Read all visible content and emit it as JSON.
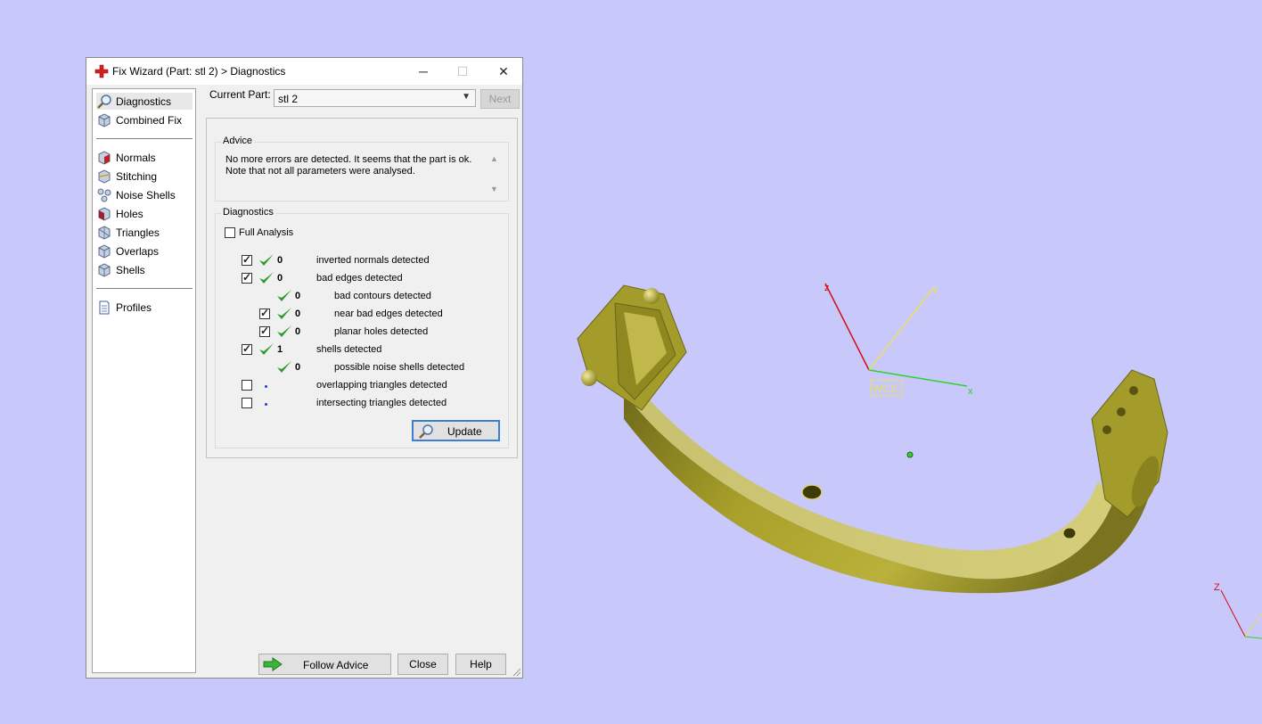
{
  "colors": {
    "viewport_bg": "#c8c8fa",
    "part": "#a8a02a",
    "axis_x": "#30d030",
    "axis_y": "#e8e060",
    "axis_z": "#d01010",
    "check": "#2e9a2e",
    "follow_arrow": "#3cb43c"
  },
  "dialog": {
    "title": "Fix Wizard (Part: stl 2) > Diagnostics",
    "title_icon": "red-cross-icon",
    "window_buttons": {
      "minimize": "─",
      "maximize": "☐",
      "close": "✕"
    }
  },
  "sidebar": {
    "items": [
      {
        "label": "Diagnostics",
        "icon": "magnifier-icon"
      },
      {
        "label": "Combined Fix",
        "icon": "cube-icon"
      },
      {
        "label": "Normals",
        "icon": "cube-red-face-icon"
      },
      {
        "label": "Stitching",
        "icon": "cube-stitch-icon"
      },
      {
        "label": "Noise Shells",
        "icon": "noise-shells-icon"
      },
      {
        "label": "Holes",
        "icon": "cube-hole-icon"
      },
      {
        "label": "Triangles",
        "icon": "cube-triangles-icon"
      },
      {
        "label": "Overlaps",
        "icon": "cube-overlap-icon"
      },
      {
        "label": "Shells",
        "icon": "cube-shells-icon"
      },
      {
        "label": "Profiles",
        "icon": "document-icon"
      }
    ]
  },
  "current_part": {
    "label": "Current Part:",
    "value": "stl 2",
    "next_label": "Next"
  },
  "advice": {
    "title": "Advice",
    "line1": "No more errors are detected. It seems that the part is ok.",
    "line2": "Note that not all parameters were analysed."
  },
  "diagnostics": {
    "title": "Diagnostics",
    "full_analysis_label": "Full Analysis",
    "full_analysis_checked": false,
    "rows": [
      {
        "checkbox": true,
        "checked": true,
        "status": "ok",
        "count": "0",
        "label": "inverted normals detected",
        "indent": 0
      },
      {
        "checkbox": true,
        "checked": true,
        "status": "ok",
        "count": "0",
        "label": "bad edges detected",
        "indent": 0
      },
      {
        "checkbox": false,
        "checked": false,
        "status": "ok",
        "count": "0",
        "label": "bad contours detected",
        "indent": 1
      },
      {
        "checkbox": true,
        "checked": true,
        "status": "ok",
        "count": "0",
        "label": "near bad edges detected",
        "indent": 1
      },
      {
        "checkbox": true,
        "checked": true,
        "status": "ok",
        "count": "0",
        "label": "planar holes detected",
        "indent": 1
      },
      {
        "checkbox": true,
        "checked": true,
        "status": "ok",
        "count": "1",
        "label": "shells detected",
        "indent": 0
      },
      {
        "checkbox": false,
        "checked": false,
        "status": "ok",
        "count": "0",
        "label": "possible noise shells detected",
        "indent": 1
      },
      {
        "checkbox": true,
        "checked": false,
        "status": "pending",
        "count": "",
        "label": "overlapping triangles detected",
        "indent": 0
      },
      {
        "checkbox": true,
        "checked": false,
        "status": "pending",
        "count": "",
        "label": "intersecting triangles detected",
        "indent": 0
      }
    ],
    "update_label": "Update"
  },
  "footer": {
    "follow_advice": "Follow Advice",
    "close": "Close",
    "help": "Help"
  },
  "viewport": {
    "wcs_label": "WCS",
    "axis_x": "x",
    "axis_y": "y",
    "axis_z": "z",
    "corner_axis_z": "Z"
  }
}
